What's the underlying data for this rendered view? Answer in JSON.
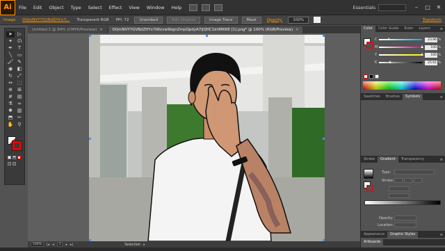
{
  "app": {
    "logo": "Ai",
    "menu": [
      "File",
      "Edit",
      "Object",
      "Type",
      "Select",
      "Effect",
      "View",
      "Window",
      "Help"
    ],
    "workspace": "Essentials",
    "window_controls": [
      "–",
      "□",
      "✕"
    ]
  },
  "control_bar": {
    "object_type": "Image",
    "linked_file": "DQmNVY7GVBdZHYx?l...",
    "color_mode": "Transparent RGB",
    "ppi": "PPI: 72",
    "unembed": "Unembed",
    "edit_original": "Edit Original",
    "image_trace": "Image Trace",
    "mask": "Mask",
    "opacity_label": "Opacity:",
    "opacity_value": "100%",
    "transform": "Transform"
  },
  "tabs": [
    {
      "label": "Untitled-1 @ 84% (CMYK/Preview)",
      "active": false
    },
    {
      "label": "DQmNVY7GVBdZHYx?iWxvw9bgnZmpQpdyA7iJQHC1khMRRE [1].png* @ 100% (RGB/Preview)",
      "active": true
    }
  ],
  "tools": [
    {
      "icon": "selection-tool-icon",
      "glyph": "➤",
      "selected": true
    },
    {
      "icon": "direct-selection-tool-icon",
      "glyph": "▷",
      "selected": false
    },
    {
      "icon": "magic-wand-tool-icon",
      "glyph": "✦",
      "selected": false
    },
    {
      "icon": "lasso-tool-icon",
      "glyph": "ᘏ",
      "selected": false
    },
    {
      "icon": "pen-tool-icon",
      "glyph": "✒",
      "selected": false
    },
    {
      "icon": "type-tool-icon",
      "glyph": "T",
      "selected": false
    },
    {
      "icon": "line-tool-icon",
      "glyph": "╲",
      "selected": false
    },
    {
      "icon": "rectangle-tool-icon",
      "glyph": "▭",
      "selected": false
    },
    {
      "icon": "paintbrush-tool-icon",
      "glyph": "🖌",
      "selected": false
    },
    {
      "icon": "pencil-tool-icon",
      "glyph": "✎",
      "selected": false
    },
    {
      "icon": "blob-brush-tool-icon",
      "glyph": "◉",
      "selected": false
    },
    {
      "icon": "eraser-tool-icon",
      "glyph": "◧",
      "selected": false
    },
    {
      "icon": "rotate-tool-icon",
      "glyph": "↻",
      "selected": false
    },
    {
      "icon": "scale-tool-icon",
      "glyph": "⤢",
      "selected": false
    },
    {
      "icon": "width-tool-icon",
      "glyph": "⇔",
      "selected": false
    },
    {
      "icon": "free-transform-tool-icon",
      "glyph": "⬚",
      "selected": false
    },
    {
      "icon": "shape-builder-tool-icon",
      "glyph": "⊕",
      "selected": false
    },
    {
      "icon": "perspective-grid-tool-icon",
      "glyph": "⊞",
      "selected": false
    },
    {
      "icon": "mesh-tool-icon",
      "glyph": "#",
      "selected": false
    },
    {
      "icon": "gradient-tool-icon",
      "glyph": "▤",
      "selected": false
    },
    {
      "icon": "eyedropper-tool-icon",
      "glyph": "⚗",
      "selected": false
    },
    {
      "icon": "blend-tool-icon",
      "glyph": "∞",
      "selected": false
    },
    {
      "icon": "symbol-sprayer-tool-icon",
      "glyph": "✺",
      "selected": false
    },
    {
      "icon": "column-graph-tool-icon",
      "glyph": "▥",
      "selected": false
    },
    {
      "icon": "artboard-tool-icon",
      "glyph": "⬒",
      "selected": false
    },
    {
      "icon": "slice-tool-icon",
      "glyph": "✂",
      "selected": false
    },
    {
      "icon": "hand-tool-icon",
      "glyph": "✋",
      "selected": false
    },
    {
      "icon": "zoom-tool-icon",
      "glyph": "⚲",
      "selected": false
    }
  ],
  "color_panel": {
    "tabs": [
      "Color",
      "Color Guide",
      "Ruler",
      "Layers"
    ],
    "channels": [
      {
        "label": "C",
        "value": "23.96",
        "track": "linear-gradient(to right, #fff, #00aeef)",
        "pct": 0.24
      },
      {
        "label": "M",
        "value": "100",
        "track": "linear-gradient(to right, #fff, #ec008c)",
        "pct": 1.0
      },
      {
        "label": "Y",
        "value": "100",
        "track": "linear-gradient(to right, #fff, #fff200)",
        "pct": 1.0
      },
      {
        "label": "K",
        "value": "25.61",
        "track": "linear-gradient(to right, #fff, #000)",
        "pct": 0.26
      }
    ],
    "percent_sign": "%"
  },
  "swatches_panel": {
    "tabs": [
      "Swatches",
      "Brushes",
      "Symbols"
    ]
  },
  "gradient_panel": {
    "tabs": [
      "Stroke",
      "Gradient",
      "Transparency"
    ],
    "type_label": "Type:",
    "stroke_label": "Stroke:",
    "opacity_label": "Opacity:",
    "location_label": "Location:"
  },
  "graphic_panel": {
    "tabs": [
      "Appearance",
      "Graphic Styles"
    ],
    "artboards_label": "Artboards"
  },
  "status_bar": {
    "zoom": "100%",
    "page": "1",
    "tool_name": "Selection"
  }
}
